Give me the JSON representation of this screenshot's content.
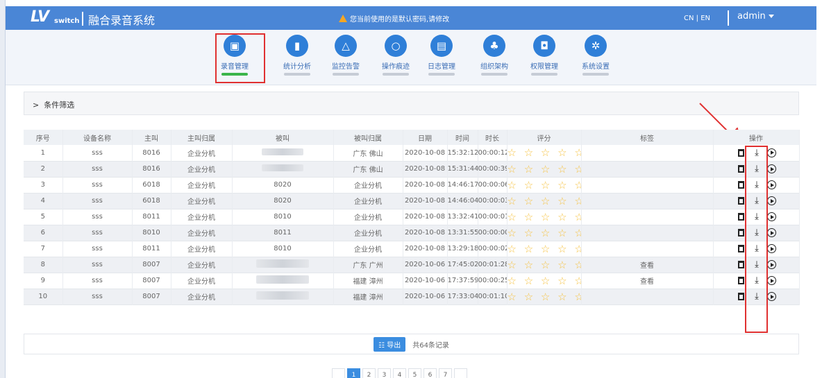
{
  "header": {
    "logo_main": "LV",
    "logo_sub": "switch",
    "title": "融合录音系统",
    "warning": "您当前使用的是默认密码,请修改",
    "lang": "CN | EN",
    "user": "admin"
  },
  "nav": [
    {
      "label": "录音管理",
      "icon": "recording-icon",
      "glyph": "▣",
      "active": true
    },
    {
      "label": "统计分析",
      "icon": "bar-chart-icon",
      "glyph": "▮",
      "active": false
    },
    {
      "label": "监控告警",
      "icon": "bell-icon",
      "glyph": "△",
      "active": false
    },
    {
      "label": "操作痕迹",
      "icon": "search-icon",
      "glyph": "○",
      "active": false
    },
    {
      "label": "日志管理",
      "icon": "notepad-icon",
      "glyph": "▤",
      "active": false
    },
    {
      "label": "组织架构",
      "icon": "org-chart-icon",
      "glyph": "♣",
      "active": false
    },
    {
      "label": "权限管理",
      "icon": "lock-icon",
      "glyph": "◘",
      "active": false
    },
    {
      "label": "系统设置",
      "icon": "gear-icon",
      "glyph": "✲",
      "active": false
    }
  ],
  "filter": {
    "label": "条件筛选"
  },
  "table": {
    "headers": [
      "序号",
      "设备名称",
      "主叫",
      "主叫归属",
      "被叫",
      "被叫归属",
      "日期",
      "时间",
      "时长",
      "评分",
      "标签",
      "操作"
    ],
    "rows": [
      {
        "no": "1",
        "device": "sss",
        "caller": "8016",
        "caller_loc": "企业分机",
        "callee": "",
        "callee_loc": "广东 佛山",
        "date": "2020-10-08",
        "time": "15:32:12",
        "duration": "00:00:12",
        "rating": "☆ ☆ ☆ ☆ ☆",
        "tag": ""
      },
      {
        "no": "2",
        "device": "sss",
        "caller": "8016",
        "caller_loc": "企业分机",
        "callee": "",
        "callee_loc": "广东 佛山",
        "date": "2020-10-08",
        "time": "15:31:44",
        "duration": "00:00:39",
        "rating": "☆ ☆ ☆ ☆ ☆",
        "tag": ""
      },
      {
        "no": "3",
        "device": "sss",
        "caller": "6018",
        "caller_loc": "企业分机",
        "callee": "8020",
        "callee_loc": "企业分机",
        "date": "2020-10-08",
        "time": "14:46:17",
        "duration": "00:00:06",
        "rating": "☆ ☆ ☆ ☆ ☆",
        "tag": ""
      },
      {
        "no": "4",
        "device": "sss",
        "caller": "6018",
        "caller_loc": "企业分机",
        "callee": "8020",
        "callee_loc": "企业分机",
        "date": "2020-10-08",
        "time": "14:46:04",
        "duration": "00:00:03",
        "rating": "☆ ☆ ☆ ☆ ☆",
        "tag": ""
      },
      {
        "no": "5",
        "device": "sss",
        "caller": "8011",
        "caller_loc": "企业分机",
        "callee": "8010",
        "callee_loc": "企业分机",
        "date": "2020-10-08",
        "time": "13:32:41",
        "duration": "00:00:01",
        "rating": "☆ ☆ ☆ ☆ ☆",
        "tag": ""
      },
      {
        "no": "6",
        "device": "sss",
        "caller": "8010",
        "caller_loc": "企业分机",
        "callee": "8011",
        "callee_loc": "企业分机",
        "date": "2020-10-08",
        "time": "13:31:55",
        "duration": "00:00:00",
        "rating": "☆ ☆ ☆ ☆ ☆",
        "tag": ""
      },
      {
        "no": "7",
        "device": "sss",
        "caller": "8011",
        "caller_loc": "企业分机",
        "callee": "8010",
        "callee_loc": "企业分机",
        "date": "2020-10-08",
        "time": "13:29:18",
        "duration": "00:00:02",
        "rating": "☆ ☆ ☆ ☆ ☆",
        "tag": ""
      },
      {
        "no": "8",
        "device": "sss",
        "caller": "8007",
        "caller_loc": "企业分机",
        "callee": "",
        "callee_loc": "广东 广州",
        "date": "2020-10-06",
        "time": "17:45:02",
        "duration": "00:01:28",
        "rating": "☆ ☆ ☆ ☆ ☆",
        "tag": "查看"
      },
      {
        "no": "9",
        "device": "sss",
        "caller": "8007",
        "caller_loc": "企业分机",
        "callee": "",
        "callee_loc": "福建 漳州",
        "date": "2020-10-06",
        "time": "17:37:59",
        "duration": "00:00:25",
        "rating": "☆ ☆ ☆ ☆ ☆",
        "tag": "查看"
      },
      {
        "no": "10",
        "device": "sss",
        "caller": "8007",
        "caller_loc": "企业分机",
        "callee": "",
        "callee_loc": "福建 漳州",
        "date": "2020-10-06",
        "time": "17:33:04",
        "duration": "00:01:10",
        "rating": "☆ ☆ ☆ ☆ ☆",
        "tag": ""
      }
    ]
  },
  "footer": {
    "export": "导出",
    "count": "共64条记录"
  },
  "pagination": [
    "1",
    "2",
    "3",
    "4",
    "5",
    "6",
    "7"
  ],
  "colors": {
    "accent": "#4a86d6",
    "nav_icon": "#2f7fd8",
    "highlight": "#e03030",
    "star": "#f6c343",
    "active_bar": "#3cb54a"
  }
}
